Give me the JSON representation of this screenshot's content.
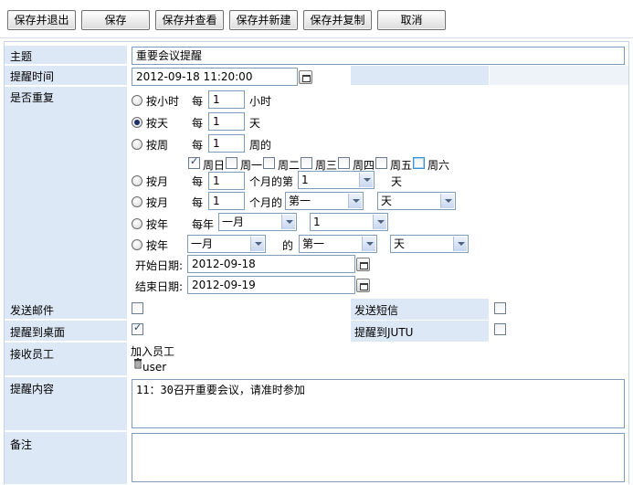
{
  "toolbar": {
    "buttons": [
      "保存并退出",
      "保存",
      "保存并查看",
      "保存并新建",
      "保存并复制",
      "取消"
    ]
  },
  "labels": {
    "subject": "主题",
    "remind_time": "提醒时间",
    "repeat": "是否重复",
    "send_mail": "发送邮件",
    "send_sms": "发送短信",
    "remind_desktop": "提醒到桌面",
    "remind_jutu": "提醒到JUTU",
    "receivers": "接收员工",
    "content": "提醒内容",
    "note": "备注"
  },
  "fields": {
    "subject_value": "重要会议提醒",
    "remind_time_value": "2012-09-18 11:20:00",
    "content_value": "11：30召开重要会议，请准时参加",
    "note_value": ""
  },
  "repeat": {
    "hour": {
      "label": "按小时",
      "every": "每",
      "value": "1",
      "unit": "小时"
    },
    "day": {
      "label": "按天",
      "every": "每",
      "value": "1",
      "unit": "天"
    },
    "week": {
      "label": "按周",
      "every": "每",
      "value": "1",
      "unit": "周的"
    },
    "weekdays": [
      {
        "label": "周日",
        "checked": true
      },
      {
        "label": "周一",
        "checked": false
      },
      {
        "label": "周二",
        "checked": false
      },
      {
        "label": "周三",
        "checked": false
      },
      {
        "label": "周四",
        "checked": false
      },
      {
        "label": "周五",
        "checked": false
      },
      {
        "label": "周六",
        "checked": false
      }
    ],
    "month1": {
      "label": "按月",
      "every": "每",
      "value": "1",
      "unit": "个月的第",
      "select": "1",
      "suffix": "天"
    },
    "month2": {
      "label": "按月",
      "every": "每",
      "value": "1",
      "unit": "个月的",
      "select1": "第一",
      "select2": "天"
    },
    "year1": {
      "label": "按年",
      "every": "每年",
      "select1": "一月",
      "select2": "1"
    },
    "year2": {
      "label": "按年",
      "select1": "一月",
      "of": "的",
      "select2": "第一",
      "select3": "天"
    },
    "start_label": "开始日期:",
    "start_value": "2012-09-18",
    "end_label": "结束日期:",
    "end_value": "2012-09-19",
    "selected": "day"
  },
  "options": {
    "send_mail": false,
    "send_sms": false,
    "remind_desktop": true,
    "remind_jutu": false
  },
  "receivers": {
    "add_label": "加入员工",
    "users": [
      "user"
    ]
  },
  "colors": {
    "label_bg": "#dde8f6",
    "border": "#7f9db9"
  }
}
